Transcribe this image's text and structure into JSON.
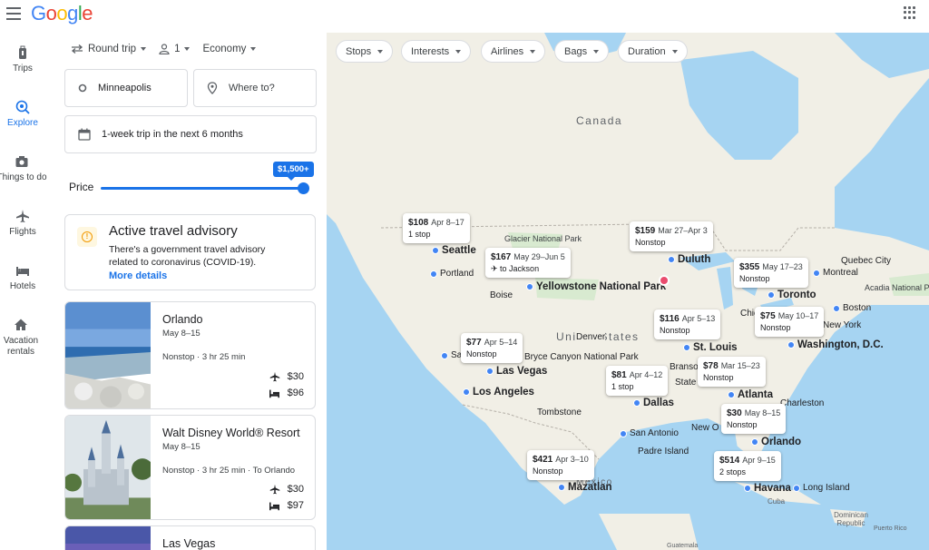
{
  "header": {
    "logo": "Google"
  },
  "rail": [
    {
      "label": "Trips",
      "icon": "luggage-icon"
    },
    {
      "label": "Explore",
      "icon": "explore-icon"
    },
    {
      "label": "Things to do",
      "icon": "camera-icon"
    },
    {
      "label": "Flights",
      "icon": "plane-icon"
    },
    {
      "label": "Hotels",
      "icon": "bed-icon"
    },
    {
      "label": "Vacation rentals",
      "icon": "house-icon"
    }
  ],
  "search": {
    "trip_type": "Round trip",
    "passengers": "1",
    "cabin": "Economy",
    "origin": "Minneapolis",
    "destination_placeholder": "Where to?",
    "dates": "1-week trip in the next 6 months",
    "price_label": "Price",
    "price_value": "$1,500+"
  },
  "advisory": {
    "title": "Active travel advisory",
    "body": "There's a government travel advisory related to coronavirus (COVID-19).",
    "link": "More details"
  },
  "results": [
    {
      "name": "Orlando",
      "dates": "May 8–15",
      "flight": "Nonstop · 3 hr 25 min",
      "flight_price": "$30",
      "hotel_price": "$96"
    },
    {
      "name": "Walt Disney World® Resort",
      "dates": "May 8–15",
      "flight": "Nonstop · 3 hr 25 min · To Orlando",
      "flight_price": "$30",
      "hotel_price": "$97"
    },
    {
      "name": "Las Vegas"
    }
  ],
  "filters": [
    "Stops",
    "Interests",
    "Airlines",
    "Bags",
    "Duration"
  ],
  "map": {
    "countries": {
      "canada": "Canada",
      "us": "United States",
      "mexico": "Mexico",
      "cuba": "Cuba",
      "dr": "Dominican Republic",
      "pr": "Puerto Rico",
      "guatemala": "Guatemala"
    },
    "cities": {
      "seattle": "Seattle",
      "portland": "Portland",
      "boise": "Boise",
      "duluth": "Duluth",
      "montreal": "Montreal",
      "quebec": "Quebec City",
      "acadia": "Acadia National Park",
      "toronto": "Toronto",
      "boston": "Boston",
      "newyork": "New York",
      "washington": "Washington, D.C.",
      "stlouis": "St. Louis",
      "chicago": "Chicago",
      "denver": "Denver",
      "yellowstone": "Yellowstone National Park",
      "glacier": "Glacier National Park",
      "brycecanyon": "Bryce Canyon National Park",
      "lasvegas": "Las Vegas",
      "losangeles": "Los Angeles",
      "santabarbara": "Santa",
      "tombstone": "Tombstone",
      "dallas": "Dallas",
      "branson": "Branson",
      "sanantonio": "San Antonio",
      "neworleans": "New O",
      "padre": "Padre Island",
      "atlanta": "Atlanta",
      "charleston": "Charleston",
      "orlando": "Orlando",
      "havana": "Havana",
      "mazatlan": "Mazatlan",
      "longisland": "Long Island",
      "state": "State"
    },
    "bubbles": {
      "seattle": {
        "price": "$108",
        "dates": "Apr 8–17",
        "note": "1 stop"
      },
      "jackson": {
        "price": "$167",
        "dates": "May 29–Jun 5",
        "note": "to Jackson"
      },
      "duluth": {
        "price": "$159",
        "dates": "Mar 27–Apr 3",
        "note": "Nonstop"
      },
      "toronto": {
        "price": "$355",
        "dates": "May 17–23",
        "note": "Nonstop"
      },
      "washington": {
        "price": "$75",
        "dates": "May 10–17",
        "note": "Nonstop"
      },
      "stlouis": {
        "price": "$116",
        "dates": "Apr 5–13",
        "note": "Nonstop"
      },
      "lasvegas": {
        "price": "$77",
        "dates": "Apr 5–14",
        "note": "Nonstop"
      },
      "dallas": {
        "price": "$81",
        "dates": "Apr 4–12",
        "note": "1 stop"
      },
      "atlanta": {
        "price": "$78",
        "dates": "Mar 15–23",
        "note": "Nonstop"
      },
      "orlando": {
        "price": "$30",
        "dates": "May 8–15",
        "note": "Nonstop"
      },
      "mazatlan": {
        "price": "$421",
        "dates": "Apr 3–10",
        "note": "Nonstop"
      },
      "havana": {
        "price": "$514",
        "dates": "Apr 9–15",
        "note": "2 stops"
      }
    }
  }
}
